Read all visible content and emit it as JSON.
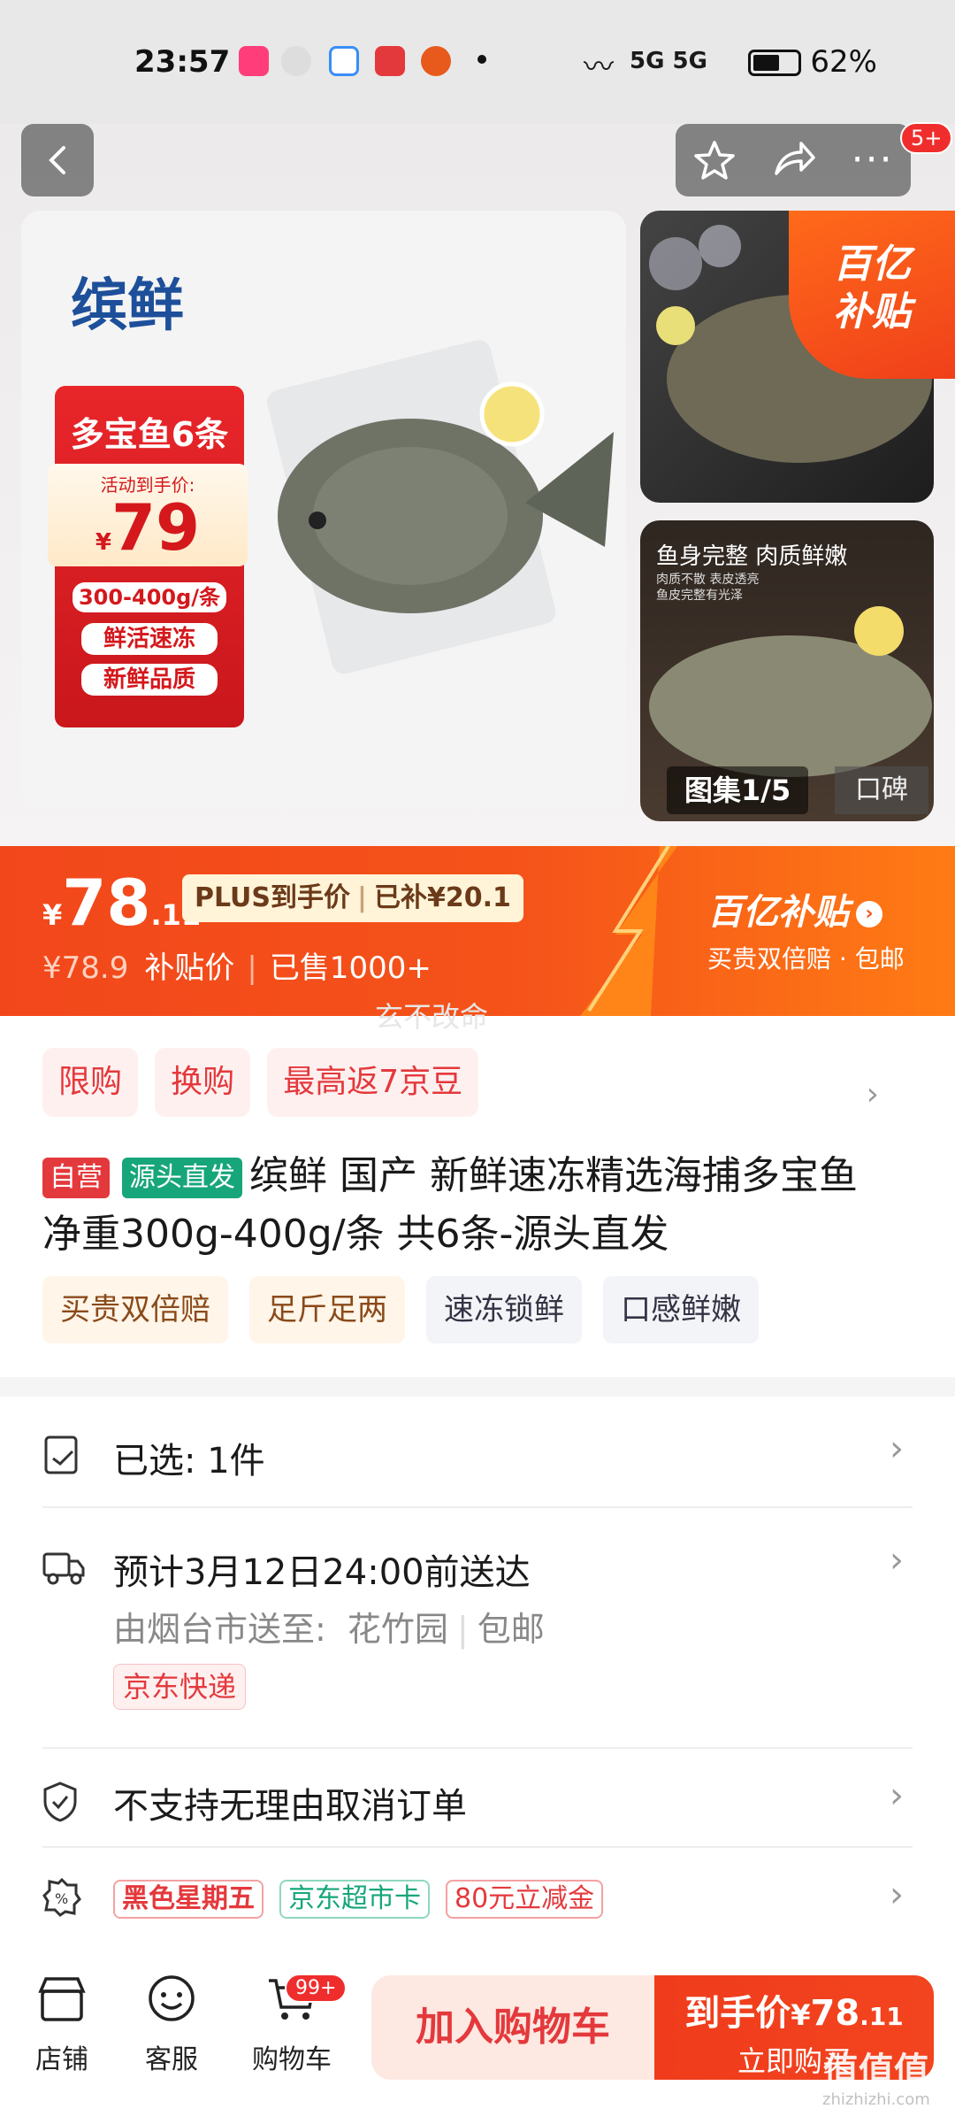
{
  "status_bar": {
    "time": "23:57",
    "signal": "5G 5G",
    "battery": "62%"
  },
  "nav": {
    "badge": "5+"
  },
  "gallery": {
    "brand": "缤鲜",
    "product_name": "多宝鱼6条",
    "activity_label": "活动到手价:",
    "currency": "¥",
    "activity_price": "79",
    "spec_1": "300-400g/条",
    "spec_2": "鲜活速冻",
    "spec_3": "新鲜品质",
    "subsidy_badge_1": "百亿",
    "subsidy_badge_2": "补贴",
    "thumb2_title": "鱼身完整 肉质鲜嫩",
    "thumb2_sub1": "肉质不散 表皮透亮",
    "thumb2_sub2": "鱼皮完整有光泽",
    "counter": "图集1/5",
    "reviews_tab": "口碑"
  },
  "price": {
    "currency": "¥",
    "integer": "78",
    "decimal": ".11",
    "plus_label": "PLUS到手价",
    "subsidized": "已补¥20.1",
    "original": "¥78.9",
    "subsidy_price_label": "补贴价",
    "sold": "已售1000+",
    "brand_right": "百亿补贴",
    "brand_right_sub": "买贵双倍赔 · 包邮",
    "watermark": "玄不改命"
  },
  "promo_tags": [
    "限购",
    "换购",
    "最高返7京豆"
  ],
  "title": {
    "badge_self": "自营",
    "badge_source": "源头直发",
    "text": "缤鲜 国产 新鲜速冻精选海捕多宝鱼净重300g-400g/条 共6条-源头直发"
  },
  "feature_tags": [
    "买贵双倍赔",
    "足斤足两",
    "速冻锁鲜",
    "口感鲜嫩"
  ],
  "rows": {
    "selected": "已选: 1件",
    "delivery_time": "预计3月12日24:00前送达",
    "ship_from": "由烟台市送至:",
    "ship_to": "花竹园",
    "shipping_fee": "包邮",
    "courier": "京东快递",
    "cancel_policy": "不支持无理由取消订单",
    "promo_1": "黑色星期五",
    "promo_2": "京东超市卡",
    "promo_3": "80元立减金"
  },
  "bottom": {
    "shop": "店铺",
    "service": "客服",
    "cart": "购物车",
    "cart_badge": "99+",
    "add_cart": "加入购物车",
    "buy_price_label": "到手价",
    "buy_currency": "¥",
    "buy_price_int": "78",
    "buy_price_dec": ".11",
    "buy_now": "立即购买",
    "site_mark": "值值值",
    "site_url": "zhizhizhi.com"
  },
  "colors": {
    "jd_red": "#e4393c",
    "orange": "#f5531a",
    "green": "#17a67a"
  }
}
